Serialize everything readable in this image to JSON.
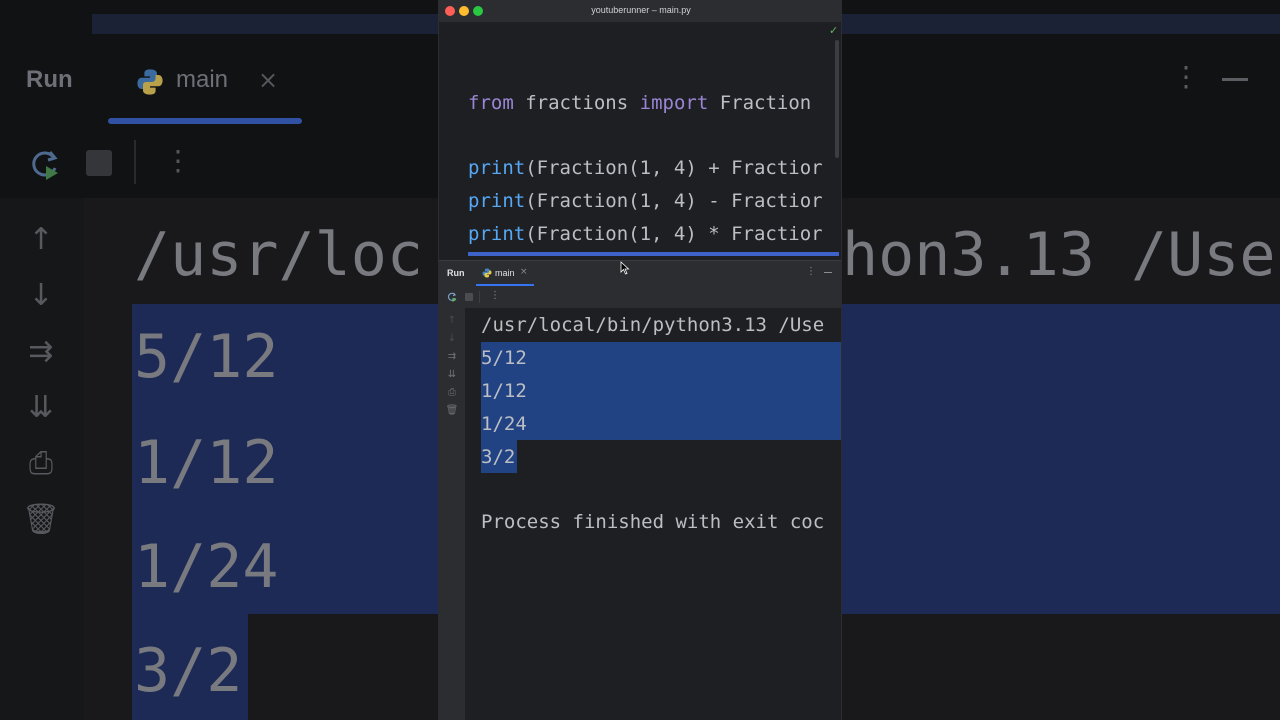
{
  "window": {
    "title": "youtuberunner – main.py"
  },
  "editor": {
    "lines": [
      {
        "kw1": "from",
        "mod": "fractions",
        "kw2": "import",
        "cls": "Fraction"
      },
      {
        "fn": "print",
        "text": "(Fraction(1, 4) + Fractior"
      },
      {
        "fn": "print",
        "text": "(Fraction(1, 4) - Fractior"
      },
      {
        "fn": "print",
        "text": "(Fraction(1, 4) * Fractior"
      }
    ]
  },
  "run_panel": {
    "label": "Run",
    "tab": "main",
    "close": "×",
    "kebab": "⋮"
  },
  "console": {
    "command": "/usr/local/bin/python3.13 /Use",
    "outputs": [
      "5/12",
      "1/12",
      "1/24",
      "3/2"
    ],
    "exit": "Process finished with exit coc"
  },
  "background": {
    "run": "Run",
    "tab": "main",
    "close": "×",
    "command_left": "/usr/loc",
    "command_right": "hon3.13 /Use",
    "outputs": [
      "5/12",
      "1/12",
      "1/24",
      "3/2"
    ]
  },
  "icons": {
    "python": "python-icon",
    "rerun": "rerun-icon",
    "stop": "stop-icon",
    "up": "up-arrow-icon",
    "down": "down-arrow-icon",
    "wrap": "soft-wrap-icon",
    "scroll": "scroll-to-end-icon",
    "print": "print-icon",
    "trash": "trash-icon",
    "check": "check-icon"
  },
  "colors": {
    "selection": "#214283",
    "accent": "#3574f0",
    "keyword": "#cf8e6d",
    "function": "#56a8f5",
    "number": "#2aacb8"
  }
}
